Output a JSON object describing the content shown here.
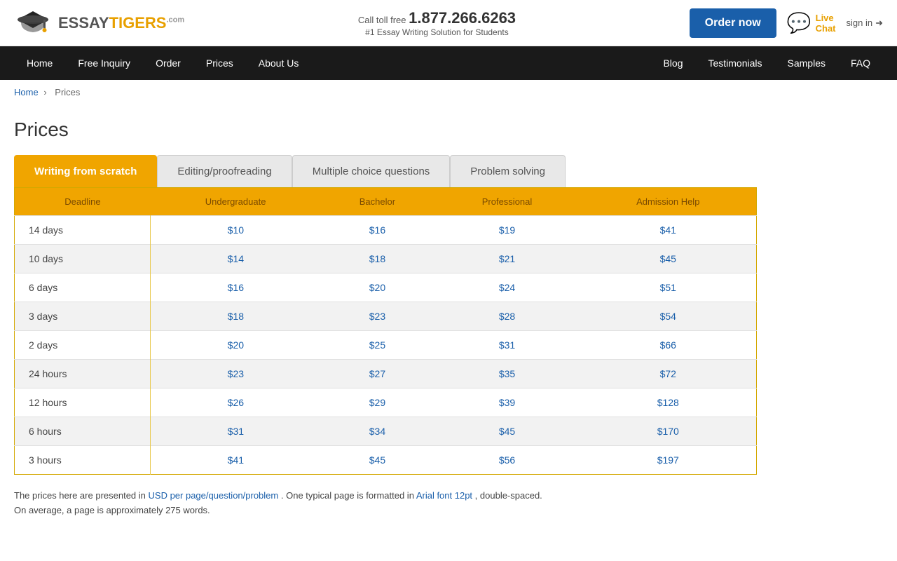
{
  "header": {
    "logo_essay": "ESSAY",
    "logo_tigers": "TIGERS",
    "logo_com": ".com",
    "phone_label": "Call toll free",
    "phone_number": "1.877.266.6263",
    "tagline": "#1 Essay Writing Solution for Students",
    "order_btn": "Order now",
    "live_chat_label": "Live\nChat",
    "sign_in_label": "sign in"
  },
  "nav": {
    "items": [
      {
        "label": "Home",
        "name": "home"
      },
      {
        "label": "Free Inquiry",
        "name": "free-inquiry"
      },
      {
        "label": "Order",
        "name": "order"
      },
      {
        "label": "Prices",
        "name": "prices"
      },
      {
        "label": "About Us",
        "name": "about-us"
      }
    ],
    "right_items": [
      {
        "label": "Blog",
        "name": "blog"
      },
      {
        "label": "Testimonials",
        "name": "testimonials"
      },
      {
        "label": "Samples",
        "name": "samples"
      },
      {
        "label": "FAQ",
        "name": "faq"
      }
    ]
  },
  "breadcrumb": {
    "home": "Home",
    "separator": "›",
    "current": "Prices"
  },
  "page": {
    "title": "Prices"
  },
  "tabs": [
    {
      "label": "Writing from scratch",
      "active": true
    },
    {
      "label": "Editing/proofreading",
      "active": false
    },
    {
      "label": "Multiple choice questions",
      "active": false
    },
    {
      "label": "Problem solving",
      "active": false
    }
  ],
  "table": {
    "headers": [
      "Deadline",
      "Undergraduate",
      "Bachelor",
      "Professional",
      "Admission Help"
    ],
    "rows": [
      {
        "deadline": "14 days",
        "undergraduate": "$10",
        "bachelor": "$16",
        "professional": "$19",
        "admission": "$41"
      },
      {
        "deadline": "10 days",
        "undergraduate": "$14",
        "bachelor": "$18",
        "professional": "$21",
        "admission": "$45"
      },
      {
        "deadline": "6 days",
        "undergraduate": "$16",
        "bachelor": "$20",
        "professional": "$24",
        "admission": "$51"
      },
      {
        "deadline": "3 days",
        "undergraduate": "$18",
        "bachelor": "$23",
        "professional": "$28",
        "admission": "$54"
      },
      {
        "deadline": "2 days",
        "undergraduate": "$20",
        "bachelor": "$25",
        "professional": "$31",
        "admission": "$66"
      },
      {
        "deadline": "24 hours",
        "undergraduate": "$23",
        "bachelor": "$27",
        "professional": "$35",
        "admission": "$72"
      },
      {
        "deadline": "12 hours",
        "undergraduate": "$26",
        "bachelor": "$29",
        "professional": "$39",
        "admission": "$128"
      },
      {
        "deadline": "6 hours",
        "undergraduate": "$31",
        "bachelor": "$34",
        "professional": "$45",
        "admission": "$170"
      },
      {
        "deadline": "3 hours",
        "undergraduate": "$41",
        "bachelor": "$45",
        "professional": "$56",
        "admission": "$197"
      }
    ]
  },
  "footer_note": {
    "text1": "The prices here are presented in",
    "highlight1": "USD per page/question/problem",
    "text2": ". One typical page is formatted in",
    "highlight2": "Arial font 12pt",
    "text3": ", double-spaced.",
    "text4": "On average, a page is approximately 275 words."
  }
}
